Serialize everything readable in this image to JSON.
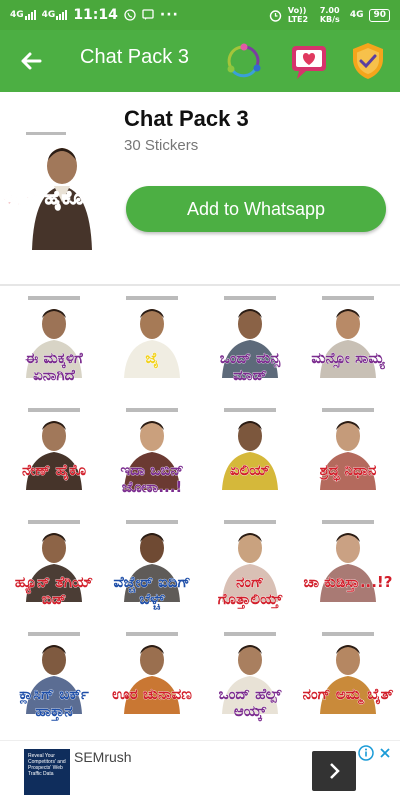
{
  "status_bar": {
    "time": "11:14",
    "net1": "4G",
    "net2": "4G",
    "volte": "Vo)) LTE2",
    "speed": "7.00 KB/s",
    "net3": "4G",
    "battery": "90",
    "icons": [
      "signal-icon",
      "signal-icon",
      "whatsapp-notification-icon",
      "sms-icon",
      "more-dots-icon",
      "alarm-icon"
    ]
  },
  "toolbar": {
    "title": "Chat Pack 3",
    "icons": [
      "back-arrow-icon",
      "share-circle-icon",
      "heart-chat-icon",
      "shield-check-icon"
    ]
  },
  "pack": {
    "title": "Chat Pack 3",
    "count": "30 Stickers",
    "add_button": "Add to Whatsapp",
    "tray_caption": "ನೇಣ್ ಹೈಕೊ"
  },
  "stickers": [
    {
      "caption": "ಈ ಮಕ್ಕಳಿಗೆ ಏನಾಗಿದೆ",
      "color": "#7b2c8f"
    },
    {
      "caption": "ಜೈ",
      "color": "#f2d21b"
    },
    {
      "caption": "ಒಂದ್ ಮನ್ಸ ಮಾಡ್",
      "color": "#7b2c8f"
    },
    {
      "caption": "ಮನ್ಸೋ ಸಾಮ್ಯ",
      "color": "#7b2c8f"
    },
    {
      "caption": "ನೇಣ್ ಹೈಕೊ",
      "color": "#d21f2b"
    },
    {
      "caption": "ಇದಾ ಒಬಿನ್ ಜೋಕಾ...!",
      "color": "#7b2c8f"
    },
    {
      "caption": "ಏಲಿಯ್",
      "color": "#d21f2b"
    },
    {
      "caption": "ಶ್ರದ್ಧ ನಿಧಾನ",
      "color": "#d21f2b"
    },
    {
      "caption": "ಹ್ಯೂನ್ ತೆಗಿಯ್ ಬಿಡ್",
      "color": "#d21f2b"
    },
    {
      "caption": "ವೆಜ್ಚೇರ್ ಐದಿಗ್ ಬೆಳ್ಚ್",
      "color": "#1e4ea8"
    },
    {
      "caption": "ನಂಗ್ ಗೊತ್ತಾಲಿಯ್ತ್",
      "color": "#d21f2b"
    },
    {
      "caption": "ಚಾ ಕುಡಿಸ್ತಾ...!?",
      "color": "#d21f2b"
    },
    {
      "caption": "ಕ್ಲಾಸಿಗ್ ಬರ್ಕ್ ಹಾಕ್ತಾನ",
      "color": "#1e4ea8"
    },
    {
      "caption": "ಊರ ಚುನಾವಣ",
      "color": "#d21f2b"
    },
    {
      "caption": "ಒಂದ್ ಹೆಲ್ಪ್ ಆಯ್ಕ್",
      "color": "#7b2c8f"
    },
    {
      "caption": "ನಂಗ್ ಅಮ್ಮ ಬೈತ್",
      "color": "#d21f2b"
    }
  ],
  "ad": {
    "advertiser": "SEMrush",
    "thumb_text": "Reveal Your Competitors' and Prospects' Web Traffic Data"
  }
}
